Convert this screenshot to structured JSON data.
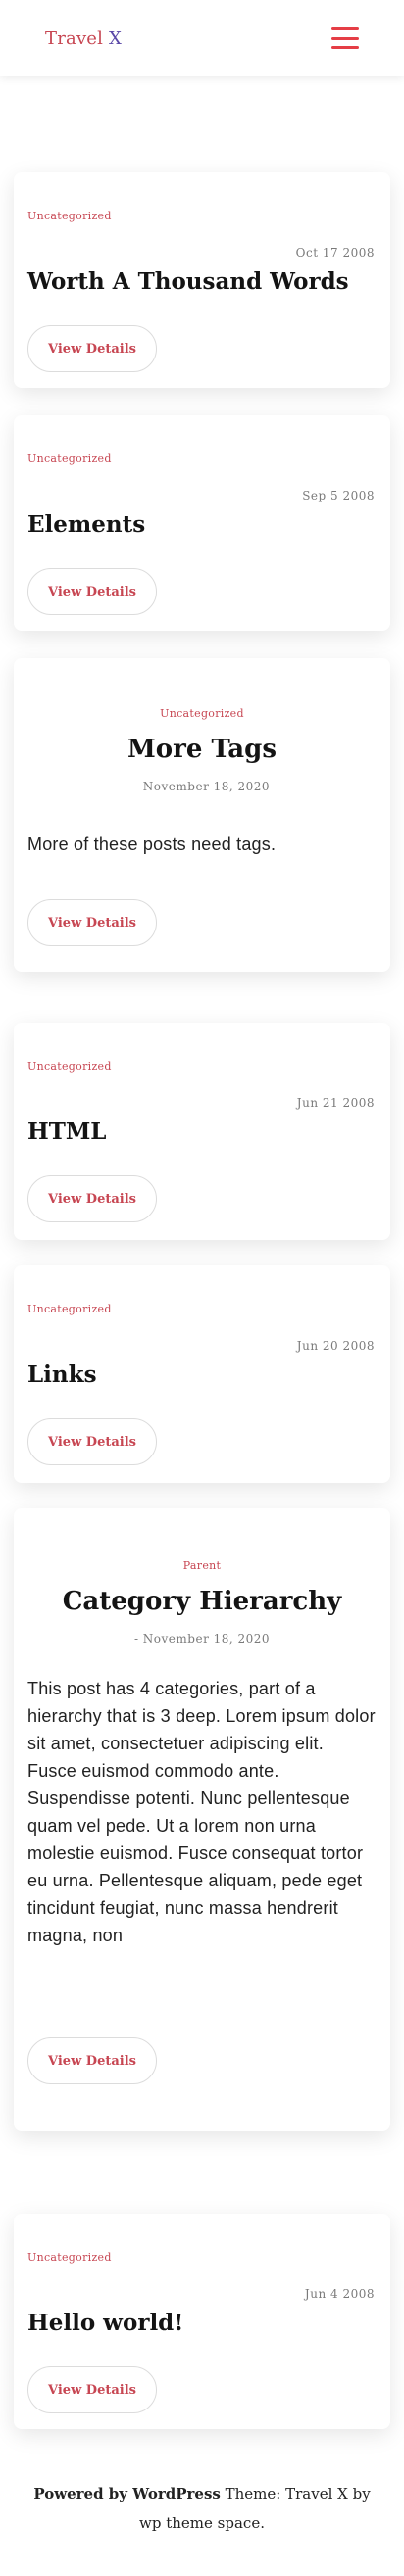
{
  "site": {
    "brand_main": "Travel ",
    "brand_x": "X"
  },
  "posts": [
    {
      "category": "Uncategorized",
      "date": "Oct 17 2008",
      "title": "Worth A Thousand Words",
      "button": "View Details"
    },
    {
      "category": "Uncategorized",
      "date": "Sep 5 2008",
      "title": "Elements",
      "button": "View Details"
    },
    {
      "category": "Uncategorized",
      "title": "More Tags",
      "meta": "- November 18, 2020",
      "excerpt": "More of these posts need tags.",
      "button": "View Details"
    },
    {
      "category": "Uncategorized",
      "date": "Jun 21 2008",
      "title": "HTML",
      "button": "View Details"
    },
    {
      "category": "Uncategorized",
      "date": "Jun 20 2008",
      "title": "Links",
      "button": "View Details"
    },
    {
      "category": "Parent",
      "title": "Category Hierarchy",
      "meta": "- November 18, 2020",
      "excerpt": "This post has 4 categories, part of a hierarchy that is 3 deep. Lorem ipsum dolor sit amet, consectetuer adipiscing elit. Fusce euismod commodo ante. Suspendisse potenti. Nunc pellentesque quam vel pede. Ut a lorem non urna molestie euismod. Fusce consequat tortor eu urna. Pellentesque aliquam, pede eget tincidunt feugiat, nunc massa hendrerit magna, non",
      "button": "View Details"
    },
    {
      "category": "Uncategorized",
      "date": "Jun 4 2008",
      "title": "Hello world!",
      "button": "View Details"
    }
  ],
  "footer": {
    "powered": "Powered by WordPress",
    "theme": " Theme: Travel X by",
    "author": "wp theme space."
  },
  "colors": {
    "accent": "#c74652",
    "menu": "#e53e46",
    "brand_x": "#5a48a8"
  }
}
